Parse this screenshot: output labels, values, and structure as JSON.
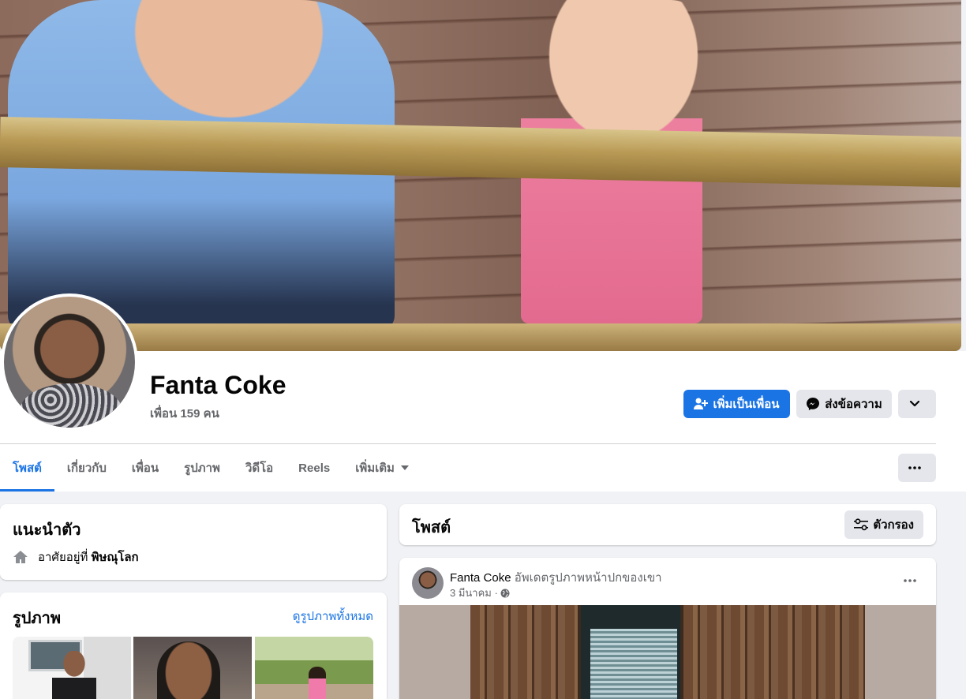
{
  "profile": {
    "name": "Fanta Coke",
    "friends_count": "เพื่อน 159 คน"
  },
  "actions": {
    "add_friend": "เพิ่มเป็นเพื่อน",
    "message": "ส่งข้อความ"
  },
  "tabs": [
    {
      "label": "โพสต์",
      "active": true
    },
    {
      "label": "เกี่ยวกับ",
      "active": false
    },
    {
      "label": "เพื่อน",
      "active": false
    },
    {
      "label": "รูปภาพ",
      "active": false
    },
    {
      "label": "วิดีโอ",
      "active": false
    },
    {
      "label": "Reels",
      "active": false
    },
    {
      "label": "เพิ่มเติม",
      "active": false
    }
  ],
  "intro": {
    "title": "แนะนำตัว",
    "lives_in_prefix": "อาศัยอยู่ที่",
    "lives_in_place": "พิษณุโลก"
  },
  "photos": {
    "title": "รูปภาพ",
    "see_all": "ดูรูปภาพทั้งหมด"
  },
  "posts_header": {
    "title": "โพสต์",
    "filter": "ตัวกรอง"
  },
  "post": {
    "author": "Fanta Coke",
    "action": "อัพเดตรูปภาพหน้าปกของเขา",
    "date": "3 มีนาคม",
    "separator": "·"
  },
  "colors": {
    "accent": "#1b74e4",
    "background": "#f0f2f5",
    "secondary_text": "#65676b",
    "button_gray": "#e4e6eb"
  }
}
